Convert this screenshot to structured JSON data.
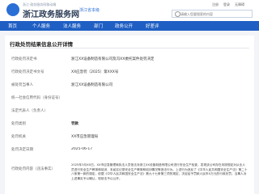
{
  "header": {
    "logo_subtitle": "浙江·政务服务网移动端",
    "logo_title": "浙江政务服务网",
    "region": "浙江省本级",
    "user_links": [
      "注册",
      "登录",
      "无障碍"
    ],
    "search": {
      "placeholder": "请输入您要搜索的内容",
      "value": ""
    }
  },
  "nav": {
    "items": [
      "首页",
      "个人服务",
      "法人服务",
      "部门",
      "政务公开",
      "好差评"
    ]
  },
  "panel": {
    "title": "行政处罚结果信息公开详情",
    "rows": [
      {
        "label": "行政处罚决定书",
        "value": "浙江XX设备制造有限公司及冯XX委托案件处罚决定"
      },
      {
        "label": "行政处罚决定书文号",
        "value": "XX应急罚〔2025〕第XXX号"
      },
      {
        "label": "被处罚当事人",
        "value": "浙江XX设备制造有限公司"
      },
      {
        "label": "统一社会信用代码（身份证号）",
        "value": ""
      },
      {
        "label": "法定代表人（负责人）",
        "value": ""
      },
      {
        "label": "处罚类别",
        "value": "罚款"
      },
      {
        "label": "处罚机关",
        "value": "XX市应急管理局"
      },
      {
        "label": "处罚决定日期",
        "value": "2025-06-17"
      }
    ],
    "content_label": "行政处罚内容（违法事实）",
    "content_text": "2025年3月XX日，XX市应急管理局执法人员依法对浙江XX设备制造有限公司进行安全生产检查，发现该公司存在未按规定对从业人员进行安全生产教育和培训、未如实记录安全生产教育和培训情况等违法行为。上述行为违反了《中华人民共和国安全生产法》第二十八条第一款的规定，依据《中华人民共和国安全生产法》第九十七条第三项的规定，决定给予罚款人民币X万元的行政处罚。当事人对上述事实予以确认，现依法予以公开。"
  }
}
